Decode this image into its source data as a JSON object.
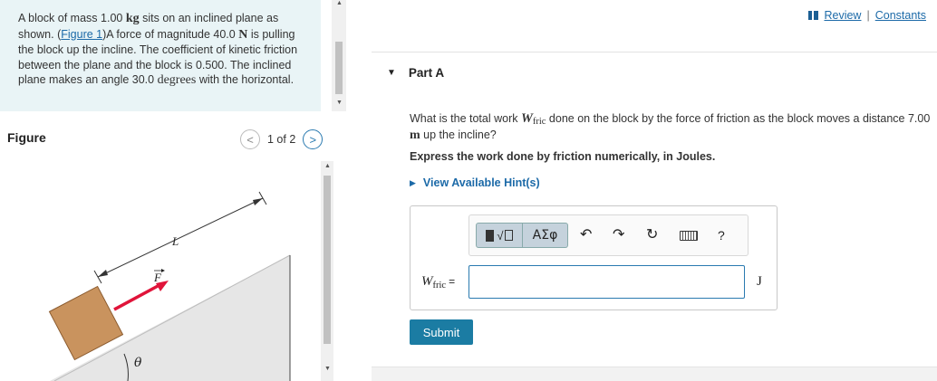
{
  "problem": {
    "t1": "A block of mass ",
    "mass": "1.00",
    "kg": "kg",
    "t2": " sits on an inclined plane as shown. (",
    "figure_link": "Figure 1",
    "t3": ")A force of magnitude ",
    "force": "40.0",
    "N": "N",
    "t4": " is pulling the block up the incline. The coefficient of kinetic friction between the plane and the block is 0.500. The inclined plane makes an angle 30.0 ",
    "degrees": "degrees",
    "t5": " with the horizontal."
  },
  "figure": {
    "label": "Figure",
    "pager_text": "1 of 2",
    "prev_glyph": "<",
    "next_glyph": ">",
    "label_L": "L",
    "label_F": "F",
    "label_theta": "θ",
    "colors": {
      "block": "#c9935e",
      "force_arrow": "#e0143a",
      "incline": "#e8e8e8"
    }
  },
  "header": {
    "review": "Review",
    "sep": "|",
    "constants": "Constants"
  },
  "part": {
    "title": "Part A",
    "q1": "What is the total work ",
    "w_sym": "W",
    "w_sub": "fric",
    "q2": " done on the block by the force of friction as the block moves a distance 7.00 ",
    "m_unit": "m",
    "q3": " up the incline?",
    "instruction": "Express the work done by friction numerically, in Joules.",
    "hints": "View Available Hint(s)"
  },
  "toolbar": {
    "greek": "ΑΣφ",
    "undo_icon": "undo-icon",
    "redo_icon": "redo-icon",
    "reset_icon": "reset-icon",
    "keyboard_icon": "keyboard-icon",
    "help": "?"
  },
  "answer": {
    "var": "W",
    "sub": "fric",
    "eq": "=",
    "value": "",
    "unit": "J"
  },
  "submit_label": "Submit"
}
